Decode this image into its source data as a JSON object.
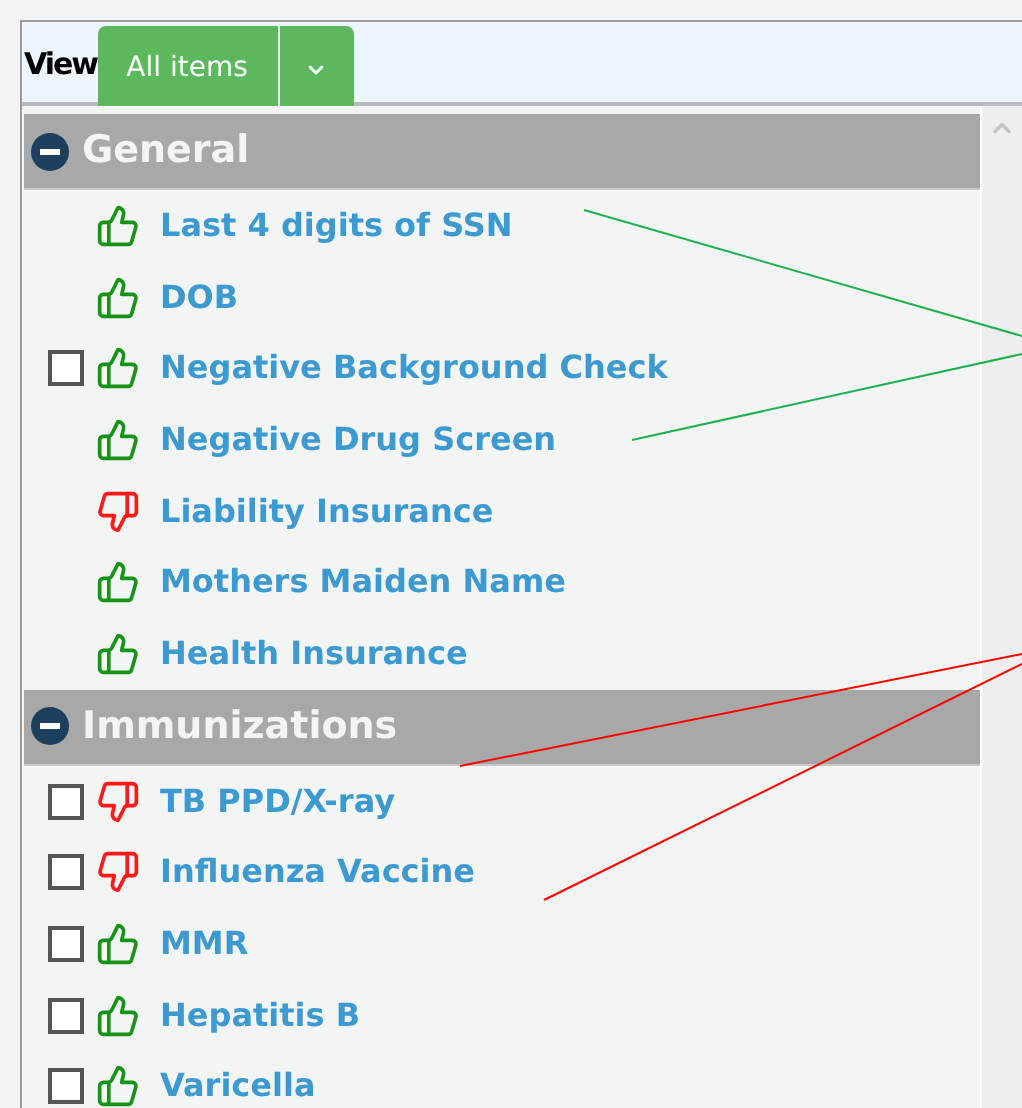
{
  "toolbar": {
    "label": "View",
    "view_button": "All items"
  },
  "groups": [
    {
      "title": "General",
      "expanded": true,
      "items": [
        {
          "label": "Last 4 digits of SSN",
          "kind": "plain",
          "approved": true
        },
        {
          "label": "DOB",
          "kind": "plain",
          "approved": true
        },
        {
          "label": "Negative Background Check",
          "kind": "checkbox",
          "checked": false,
          "approved": true
        },
        {
          "label": "Negative Drug Screen",
          "kind": "plain",
          "approved": true
        },
        {
          "label": "Liability Insurance",
          "kind": "plain",
          "approved": false
        },
        {
          "label": "Mothers Maiden Name",
          "kind": "plain",
          "approved": true
        },
        {
          "label": "Health Insurance",
          "kind": "plain",
          "approved": true
        }
      ]
    },
    {
      "title": "Immunizations",
      "expanded": true,
      "items": [
        {
          "label": "TB PPD/X-ray",
          "kind": "checkbox",
          "checked": false,
          "approved": false
        },
        {
          "label": "Influenza Vaccine",
          "kind": "checkbox",
          "checked": false,
          "approved": false
        },
        {
          "label": "MMR",
          "kind": "checkbox",
          "checked": false,
          "approved": true
        },
        {
          "label": "Hepatitis B",
          "kind": "checkbox",
          "checked": false,
          "approved": true
        },
        {
          "label": "Varicella",
          "kind": "checkbox",
          "checked": false,
          "approved": true
        }
      ]
    }
  ]
}
